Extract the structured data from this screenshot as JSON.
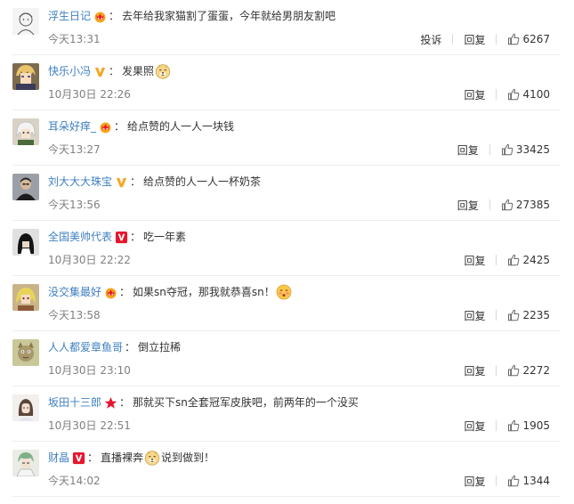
{
  "comments": [
    {
      "avatar": "avatar-sketch",
      "user": "浮生日记",
      "badge": "crown-badge-icon",
      "text": "去年给我家猫割了蛋蛋，今年就给男朋友割吧",
      "text_after": "",
      "emoji": "",
      "time": "今天13:31",
      "report": "投诉",
      "reply": "回复",
      "likes": "6267"
    },
    {
      "avatar": "avatar-anime-blond",
      "user": "快乐小冯",
      "badge": "verified-v-gold-icon",
      "text": "发果照",
      "text_after": "",
      "emoji": "doge-emoji-icon",
      "time": "10月30日 22:26",
      "report": "",
      "reply": "回复",
      "likes": "4100"
    },
    {
      "avatar": "avatar-anime-white",
      "user": "耳朵好痒_",
      "badge": "crown-badge-icon",
      "text": "给点赞的人一人一块钱",
      "text_after": "",
      "emoji": "",
      "time": "今天13:27",
      "report": "",
      "reply": "回复",
      "likes": "33425"
    },
    {
      "avatar": "avatar-photo-man",
      "user": "刘大大大珠宝",
      "badge": "verified-v-gold-icon",
      "text": "给点赞的人一人一杯奶茶",
      "text_after": "",
      "emoji": "",
      "time": "今天13:56",
      "report": "",
      "reply": "回复",
      "likes": "27385"
    },
    {
      "avatar": "avatar-dark-hair",
      "user": "全国美帅代表",
      "badge": "verified-v-red-icon",
      "text": "吃一年素",
      "text_after": "",
      "emoji": "",
      "time": "10月30日 22:22",
      "report": "",
      "reply": "回复",
      "likes": "2425"
    },
    {
      "avatar": "avatar-anime-girl",
      "user": "没交集最好",
      "badge": "crown-badge-icon",
      "text": "如果sn夺冠，那我就恭喜sn！",
      "text_after": "",
      "emoji": "shy-face-emoji-icon",
      "time": "今天13:58",
      "report": "",
      "reply": "回复",
      "likes": "2235"
    },
    {
      "avatar": "avatar-cat-cartoon",
      "user": "人人都爱章鱼哥",
      "badge": "",
      "text": "倒立拉稀",
      "text_after": "",
      "emoji": "",
      "time": "10月30日 23:10",
      "report": "",
      "reply": "回复",
      "likes": "2272"
    },
    {
      "avatar": "avatar-girl-photo",
      "user": "坂田十三郎",
      "badge": "star-badge-icon",
      "text": "那就买下sn全套冠军皮肤吧，前两年的一个没买",
      "text_after": "",
      "emoji": "",
      "time": "10月30日 22:51",
      "report": "",
      "reply": "回复",
      "likes": "1905"
    },
    {
      "avatar": "avatar-anime-green",
      "user": "财晶",
      "badge": "verified-v-red-icon",
      "text": "直播裸奔",
      "text_after": "说到做到！",
      "emoji": "doge-emoji-icon",
      "time": "今天14:02",
      "report": "",
      "reply": "回复",
      "likes": "1344"
    }
  ],
  "colors": {
    "username": "#3e7fc1",
    "meta": "#808080",
    "text": "#333333",
    "divider": "#eeeeee",
    "gold_v": "#f5a623",
    "red_v": "#e6162d"
  }
}
